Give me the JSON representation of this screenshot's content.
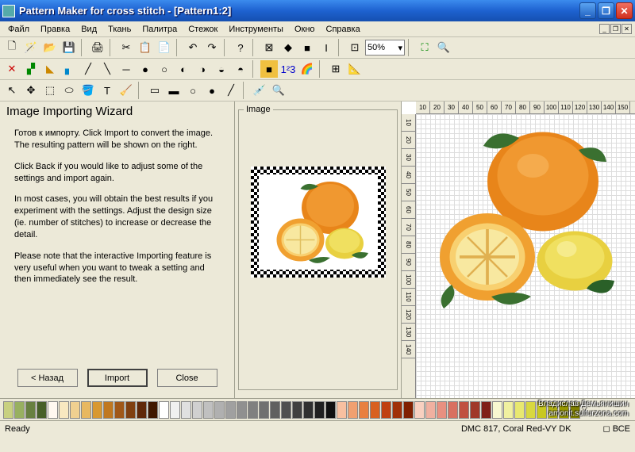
{
  "window": {
    "title": "Pattern Maker for cross stitch - [Pattern1:2]"
  },
  "menu": {
    "items": [
      "Файл",
      "Правка",
      "Вид",
      "Ткань",
      "Палитра",
      "Стежок",
      "Инструменты",
      "Окно",
      "Справка"
    ]
  },
  "toolbar1": {
    "zoom": "50%"
  },
  "wizard": {
    "title": "Image Importing Wizard",
    "p1": "Готов к импорту.  Click Import to convert the image.  The resulting pattern will be shown on the right.",
    "p2": "Click Back if you would like to adjust some of the settings and import again.",
    "p3": "In most cases, you will obtain the best results if you experiment with the settings.  Adjust the design size (ie. number of stitches) to increase or decrease the detail.",
    "p4": "Please note that the interactive Importing feature is very useful when you want to tweak a setting and then immediately see the result.",
    "back": "< Назад",
    "import": "Import",
    "close": "Close"
  },
  "midpanel": {
    "legend": "Image"
  },
  "ruler_h": [
    "10",
    "20",
    "30",
    "40",
    "50",
    "60",
    "70",
    "80",
    "90",
    "100",
    "110",
    "120",
    "130",
    "140",
    "150"
  ],
  "ruler_v": [
    "10",
    "20",
    "30",
    "40",
    "50",
    "60",
    "70",
    "80",
    "90",
    "100",
    "110",
    "120",
    "130",
    "140"
  ],
  "watermark": {
    "l1": "Владислав Демьянишин",
    "l2": "amonit.sulfurzona.com"
  },
  "status": {
    "ready": "Ready",
    "thread": "DMC  817, Coral Red-VY DK",
    "all": "◻ ВСЕ"
  },
  "palette": [
    "#c8d080",
    "#98b060",
    "#688040",
    "#486028",
    "#fff8f0",
    "#f8e8c0",
    "#f0d090",
    "#e8b860",
    "#d89830",
    "#c07820",
    "#a05818",
    "#804010",
    "#602808",
    "#401800",
    "#ffffff",
    "#f0f0f0",
    "#e0e0e0",
    "#d0d0d0",
    "#c0c0c0",
    "#b0b0b0",
    "#a0a0a0",
    "#909090",
    "#808080",
    "#707070",
    "#606060",
    "#505050",
    "#404040",
    "#303030",
    "#202020",
    "#101010",
    "#f8c0a0",
    "#f0a070",
    "#e88040",
    "#d86020",
    "#c04010",
    "#a03008",
    "#802000",
    "#f8d0c0",
    "#f0b0a0",
    "#e89080",
    "#d87060",
    "#c05040",
    "#a03828",
    "#802018",
    "#f8f8d0",
    "#f0f0a0",
    "#e8e870",
    "#d8d840",
    "#c8c820",
    "#b0b010",
    "#989800",
    "#808000"
  ]
}
